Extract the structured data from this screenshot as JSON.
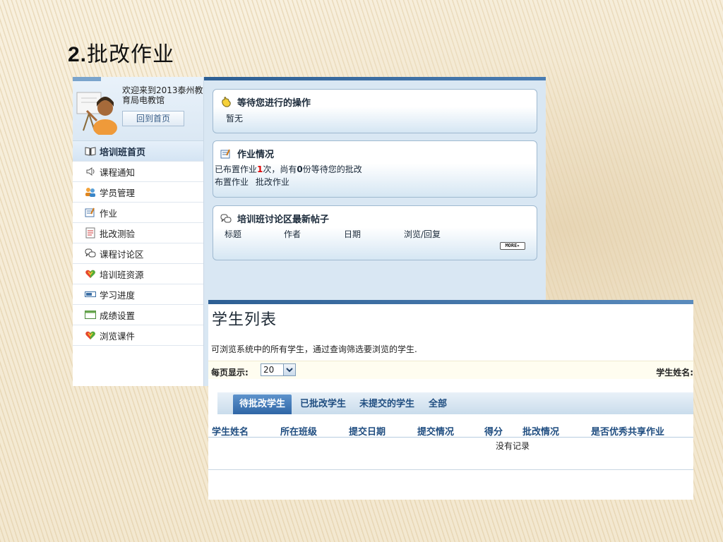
{
  "slide": {
    "number": "2.",
    "title": "批改作业"
  },
  "sidebar": {
    "welcome": "欢迎来到2013泰州教育局电教馆",
    "home_button": "回到首页",
    "items": [
      {
        "label": "培训班首页",
        "icon": "open-book-icon"
      },
      {
        "label": "课程通知",
        "icon": "speaker-icon"
      },
      {
        "label": "学员管理",
        "icon": "users-icon"
      },
      {
        "label": "作业",
        "icon": "homework-icon"
      },
      {
        "label": "批改测验",
        "icon": "quiz-icon"
      },
      {
        "label": "课程讨论区",
        "icon": "chat-bubbles-icon"
      },
      {
        "label": "培训班资源",
        "icon": "heart-icon"
      },
      {
        "label": "学习进度",
        "icon": "progress-bar-icon"
      },
      {
        "label": "成绩设置",
        "icon": "table-icon"
      },
      {
        "label": "浏览课件",
        "icon": "heart-icon"
      }
    ]
  },
  "panels": {
    "pending": {
      "title": "等待您进行的操作",
      "text": "暂无",
      "icon": "hand-icon"
    },
    "homework": {
      "title": "作业情况",
      "icon": "homework-icon",
      "line_prefix": "已布置作业",
      "assigned_count": "1",
      "line_mid": "次，尚有",
      "pending_count": "0",
      "line_suffix": "份等待您的批改",
      "link_assign": "布置作业",
      "link_grade": "批改作业"
    },
    "forum": {
      "title": "培训班讨论区最新帖子",
      "icon": "chat-bubbles-icon",
      "columns": [
        "标题",
        "作者",
        "日期",
        "浏览/回复"
      ],
      "more_label": "MORE▸"
    }
  },
  "student_list": {
    "title": "学生列表",
    "description": "可浏览系统中的所有学生，通过查询筛选要浏览的学生.",
    "per_page_label": "每页显示:",
    "per_page_value": "20",
    "name_label": "学生姓名:",
    "tabs": [
      "待批改学生",
      "已批改学生",
      "未提交的学生",
      "全部"
    ],
    "active_tab": "待批改学生",
    "columns": [
      "学生姓名",
      "所在班级",
      "提交日期",
      "提交情况",
      "得分",
      "批改情况",
      "是否优秀共享作业"
    ],
    "empty_text": "没有记录"
  },
  "colors": {
    "accent": "#2f66a6",
    "panel_bg": "#d9e7f3",
    "header_text": "#1f4d80",
    "highlight_red": "#dd0000"
  }
}
